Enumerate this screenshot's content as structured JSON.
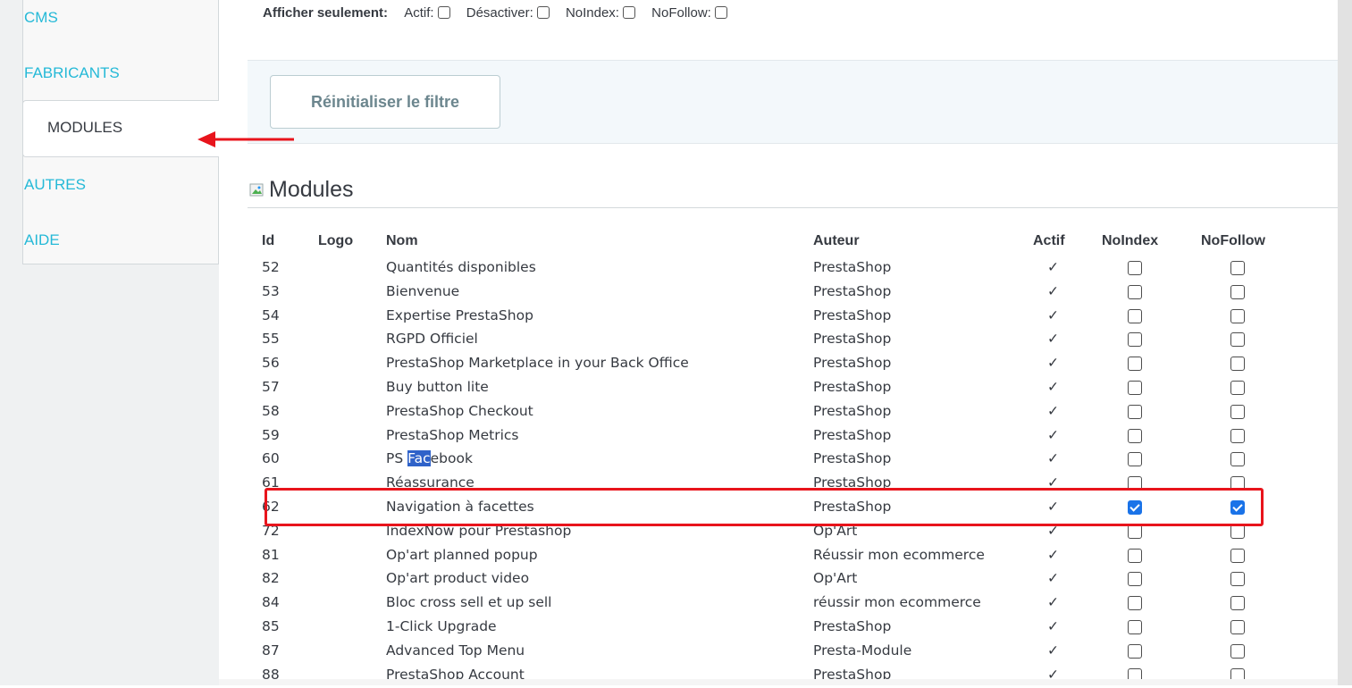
{
  "sidebar": {
    "tabs": [
      {
        "label": "CMS",
        "active": false
      },
      {
        "label": "FABRICANTS",
        "active": false
      },
      {
        "label": "MODULES",
        "active": true
      },
      {
        "label": "AUTRES",
        "active": false
      },
      {
        "label": "AIDE",
        "active": false
      }
    ]
  },
  "filter": {
    "label": "Afficher seulement:",
    "options": [
      "Actif:",
      "Désactiver:",
      "NoIndex:",
      "NoFollow:"
    ],
    "reset_button": "Réinitialiser le filtre"
  },
  "section": {
    "title": "Modules"
  },
  "table": {
    "headers": [
      "Id",
      "Logo",
      "Nom",
      "Auteur",
      "Actif",
      "NoIndex",
      "NoFollow"
    ],
    "active_mark": "✓",
    "rows": [
      {
        "id": "52",
        "nom": "Quantités disponibles",
        "auteur": "PrestaShop",
        "noindex": false,
        "nofollow": false
      },
      {
        "id": "53",
        "nom": "Bienvenue",
        "auteur": "PrestaShop",
        "noindex": false,
        "nofollow": false
      },
      {
        "id": "54",
        "nom": "Expertise PrestaShop",
        "auteur": "PrestaShop",
        "noindex": false,
        "nofollow": false
      },
      {
        "id": "55",
        "nom": "RGPD Officiel",
        "auteur": "PrestaShop",
        "noindex": false,
        "nofollow": false
      },
      {
        "id": "56",
        "nom": "PrestaShop Marketplace in your Back Office",
        "auteur": "PrestaShop",
        "noindex": false,
        "nofollow": false
      },
      {
        "id": "57",
        "nom": "Buy button lite",
        "auteur": "PrestaShop",
        "noindex": false,
        "nofollow": false
      },
      {
        "id": "58",
        "nom": "PrestaShop Checkout",
        "auteur": "PrestaShop",
        "noindex": false,
        "nofollow": false
      },
      {
        "id": "59",
        "nom": "PrestaShop Metrics",
        "auteur": "PrestaShop",
        "noindex": false,
        "nofollow": false
      },
      {
        "id": "60",
        "nom": "PS Facebook",
        "auteur": "PrestaShop",
        "noindex": false,
        "nofollow": false
      },
      {
        "id": "61",
        "nom": "Réassurance",
        "auteur": "PrestaShop",
        "noindex": false,
        "nofollow": false
      },
      {
        "id": "62",
        "nom": "Navigation à facettes",
        "auteur": "PrestaShop",
        "noindex": true,
        "nofollow": true
      },
      {
        "id": "72",
        "nom": "IndexNow pour Prestashop",
        "auteur": "Op'Art",
        "noindex": false,
        "nofollow": false
      },
      {
        "id": "81",
        "nom": "Op'art planned popup",
        "auteur": "Réussir mon ecommerce",
        "noindex": false,
        "nofollow": false
      },
      {
        "id": "82",
        "nom": "Op'art product video",
        "auteur": "Op'Art",
        "noindex": false,
        "nofollow": false
      },
      {
        "id": "84",
        "nom": "Bloc cross sell et up sell",
        "auteur": "réussir mon ecommerce",
        "noindex": false,
        "nofollow": false
      },
      {
        "id": "85",
        "nom": "1-Click Upgrade",
        "auteur": "PrestaShop",
        "noindex": false,
        "nofollow": false
      },
      {
        "id": "87",
        "nom": "Advanced Top Menu",
        "auteur": "Presta-Module",
        "noindex": false,
        "nofollow": false
      },
      {
        "id": "88",
        "nom": "PrestaShop Account",
        "auteur": "PrestaShop",
        "noindex": false,
        "nofollow": false
      }
    ]
  },
  "colors": {
    "link": "#25b9d7",
    "annotation": "#e8141c",
    "checked": "#1a73e8"
  }
}
